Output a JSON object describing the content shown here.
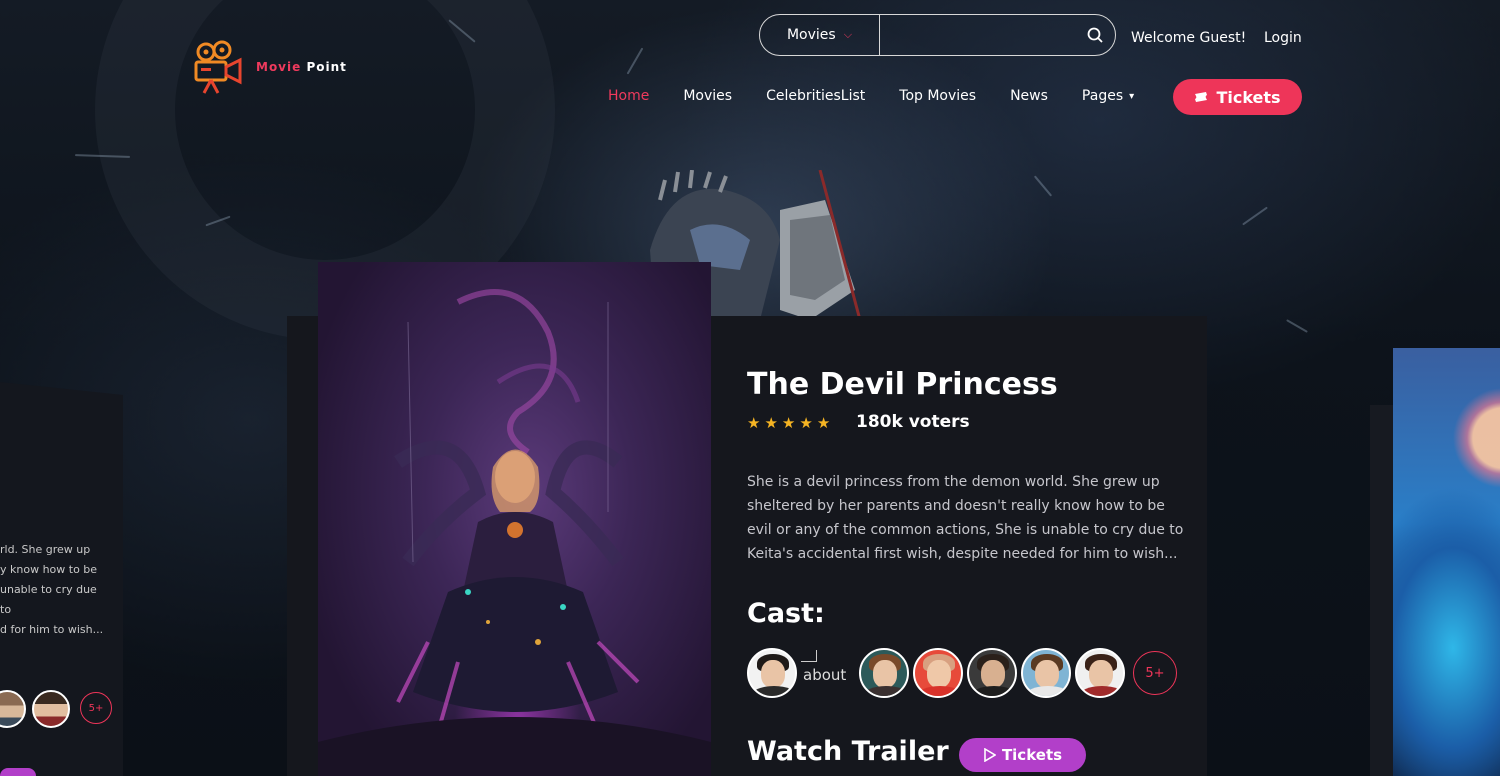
{
  "logo": {
    "text_first": "Movie",
    "text_second": " Point",
    "accent": "#ef3a5d"
  },
  "search": {
    "category": "Movies",
    "placeholder": "",
    "value": ""
  },
  "header": {
    "welcome": "Welcome Guest!",
    "login": "Login"
  },
  "nav": {
    "items": [
      "Home",
      "Movies",
      "CelebritiesList",
      "Top Movies",
      "News",
      "Pages"
    ],
    "active": "Home",
    "tickets_label": "Tickets"
  },
  "left_card": {
    "text": "rld. She grew up\ny know how to be\nunable to cry due to\nd for him to wish...",
    "more": "5+"
  },
  "movie": {
    "title": "The Devil Princess",
    "rating_stars": 5,
    "voters": "180k voters",
    "description": "She is a devil princess from the demon world. She grew up sheltered by her parents and doesn't really know how to be evil or any of the common actions, She is unable to cry due to Keita's accidental first wish, despite needed for him to wish...",
    "cast_heading": "Cast:",
    "cast_broken_alt": "about",
    "cast_more": "5+",
    "watch_trailer": "Watch Trailer",
    "trailer_button": "Tickets"
  },
  "colors": {
    "accent_red": "#ee3559",
    "accent_purple": "#b23fc9",
    "star": "#f5b423",
    "card_bg": "#15171d"
  },
  "icons": [
    "camera-logo-icon",
    "chevron-down-icon",
    "search-icon",
    "ticket-icon",
    "play-icon",
    "star-icon"
  ]
}
